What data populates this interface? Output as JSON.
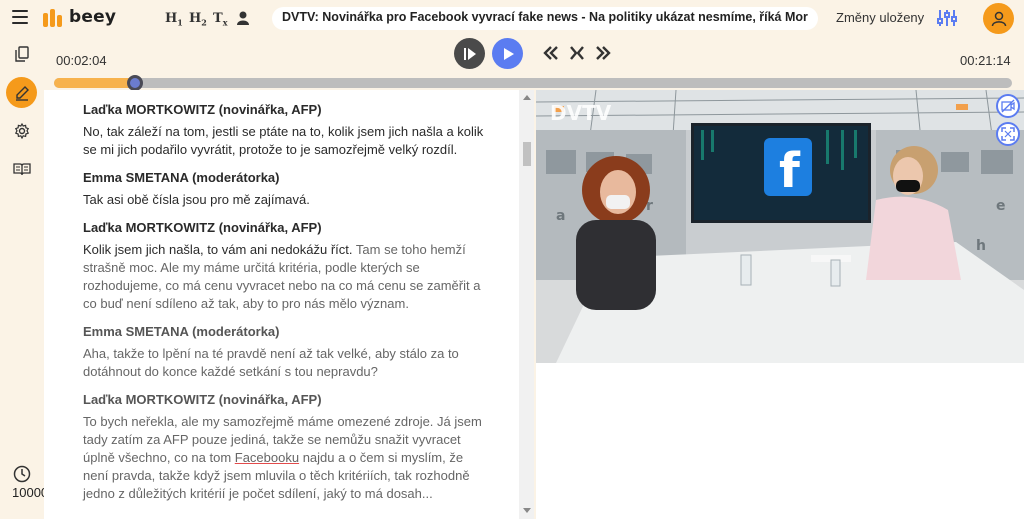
{
  "header": {
    "logo": "beey",
    "format_buttons": [
      "H",
      "H",
      "T"
    ],
    "format_subs": [
      "1",
      "2",
      "x"
    ],
    "document_title": "DVTV: Novinářka pro Facebook vyvrací fake news - Na politiky ukázat nesmíme, říká Mor",
    "save_status": "Změny uloženy"
  },
  "sidebar": {
    "credits": "10000"
  },
  "player": {
    "current_time": "00:02:04",
    "total_time": "00:21:14",
    "progress": 0.085
  },
  "transcript": [
    {
      "speaker": "Laďka MORTKOWITZ (novinářka, AFP)",
      "text": "No, tak záleží na tom, jestli se ptáte na to, kolik jsem jich našla a kolik se mi jich podařilo vyvrátit, protože to je samozřejmě velký rozdíl."
    },
    {
      "speaker": "Emma SMETANA (moderátorka)",
      "text": "Tak asi obě čísla jsou pro mě zajímavá."
    },
    {
      "speaker": "Laďka MORTKOWITZ (novinářka, AFP)",
      "text_played": "Kolik jsem jich našla, to vám ani nedokážu říct.",
      "text_rest": " Tam se toho hemží strašně moc. Ale my máme určitá kritéria, podle kterých se rozhodujeme, co má cenu vyvracet nebo na co má cenu se zaměřit a co buď není sdíleno až tak, aby to pro nás mělo význam."
    },
    {
      "speaker": "Emma SMETANA (moderátorka)",
      "text": "Aha, takže to lpění na té pravdě není až tak velké, aby stálo za to dotáhnout do konce každé setkání s tou nepravdu?"
    },
    {
      "speaker": "Laďka MORTKOWITZ (novinářka, AFP)",
      "text_before": "To bych neřekla, ale my samozřejmě máme omezené zdroje. Já jsem tady zatím za AFP pouze jediná, takže se nemůžu snažit vyvracet úplně všechno, co na tom ",
      "text_marked": "Facebooku",
      "text_after": " najdu a o čem si myslím, že není pravda, takže když jsem mluvila o těch kritériích, tak rozhodně jedno z důležitých kritérií je počet sdílení, jaký to má dosah..."
    }
  ],
  "video": {
    "watermark": "DVTV"
  },
  "colors": {
    "accent": "#f59a1b",
    "play": "#5b7cf1",
    "background": "#fbf3e6"
  }
}
